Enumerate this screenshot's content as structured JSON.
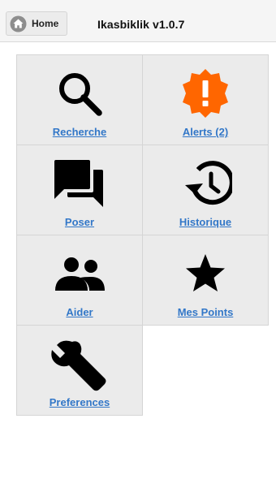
{
  "header": {
    "home_label": "Home",
    "title": "Ikasbiklik v1.0.7"
  },
  "colors": {
    "link": "#3277c8",
    "alert_accent": "#ff6600",
    "tile_bg": "#ebebeb"
  },
  "tiles": [
    {
      "label": "Recherche",
      "icon": "search-icon"
    },
    {
      "label": "Alerts (2)",
      "icon": "alert-badge-icon"
    },
    {
      "label": "Poser",
      "icon": "chat-bubbles-icon"
    },
    {
      "label": "Historique",
      "icon": "history-icon"
    },
    {
      "label": "Aider",
      "icon": "people-icon"
    },
    {
      "label": "Mes Points",
      "icon": "star-icon"
    },
    {
      "label": "Preferences",
      "icon": "wrench-icon"
    }
  ]
}
